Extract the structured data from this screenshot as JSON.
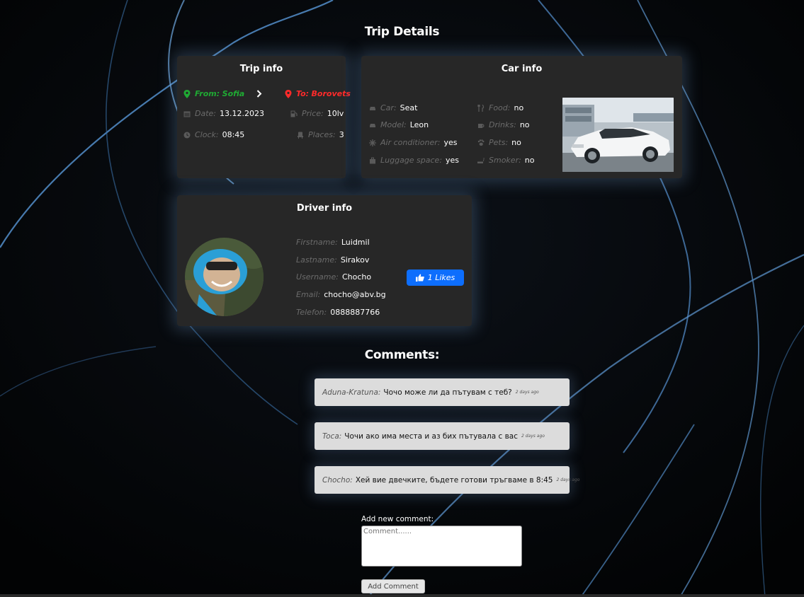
{
  "page_title": "Trip Details",
  "trip_info": {
    "title": "Trip info",
    "from_label": "From:",
    "from_value": "Sofia",
    "to_label": "To:",
    "to_value": "Borovets",
    "date_label": "Date:",
    "date_value": "13.12.2023",
    "price_label": "Price:",
    "price_value": "10lv",
    "clock_label": "Clock:",
    "clock_value": "08:45",
    "places_label": "Places:",
    "places_value": "3"
  },
  "car_info": {
    "title": "Car info",
    "car_label": "Car:",
    "car_value": "Seat",
    "model_label": "Model:",
    "model_value": "Leon",
    "ac_label": "Air conditioner:",
    "ac_value": "yes",
    "luggage_label": "Luggage space:",
    "luggage_value": "yes",
    "food_label": "Food:",
    "food_value": "no",
    "drinks_label": "Drinks:",
    "drinks_value": "no",
    "pets_label": "Pets:",
    "pets_value": "no",
    "smoker_label": "Smoker:",
    "smoker_value": "no"
  },
  "driver_info": {
    "title": "Driver info",
    "firstname_label": "Firstname:",
    "firstname_value": "Luidmil",
    "lastname_label": "Lastname:",
    "lastname_value": "Sirakov",
    "username_label": "Username:",
    "username_value": "Chocho",
    "email_label": "Email:",
    "email_value": "chocho@abv.bg",
    "telefon_label": "Telefon:",
    "telefon_value": "0888887766",
    "likes_label": "1 Likes"
  },
  "comments_title": "Comments:",
  "comments": [
    {
      "author": "Aduna-Kratuna:",
      "text": "Чочо може ли да пътувам с теб?",
      "time": "2 days ago"
    },
    {
      "author": "Toca:",
      "text": "Чочи ако има места и аз бих пътувала с вас",
      "time": "2 days ago"
    },
    {
      "author": "Chocho:",
      "text": "Хей вие двечките, бъдете готови тръгваме в 8:45",
      "time": "2 days ago"
    }
  ],
  "new_comment": {
    "label": "Add new comment:",
    "placeholder": "Comment......",
    "button": "Add Comment"
  },
  "colors": {
    "from_green": "#1faa33",
    "to_red": "#ff2a2a",
    "likes_blue": "#0d6efd",
    "card_bg": "#272727"
  }
}
